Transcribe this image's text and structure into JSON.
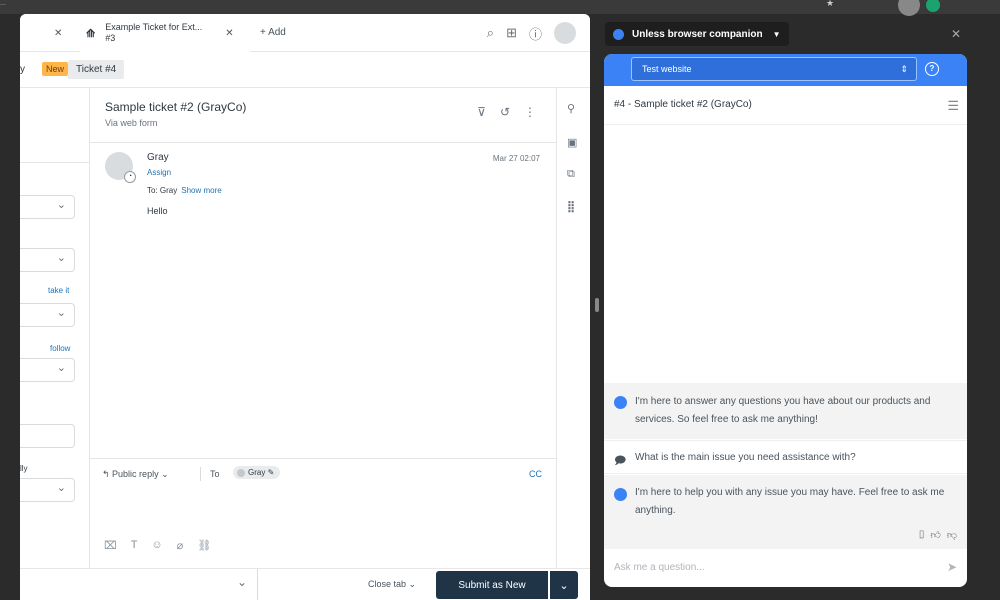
{
  "browser": {
    "url_fragment": "...",
    "colors": {
      "chrome": "#3a3a3a"
    }
  },
  "zendesk": {
    "tabs": [
      {
        "label": ""
      },
      {
        "label": "Example Ticket for Ext...",
        "sublabel": "#3"
      }
    ],
    "add_tab_label": "+ Add",
    "subbar": {
      "crumb_tail": "y",
      "new_badge": "New",
      "ticket_chip": "Ticket #4"
    },
    "left_panel": {
      "take_it": "take it",
      "follow": "follow",
      "ly_label": "lly"
    },
    "ticket": {
      "title": "Sample ticket #2 (GrayCo)",
      "channel": "Via web form",
      "message": {
        "author": "Gray",
        "assign": "Assign",
        "to_prefix": "To: Gray",
        "show_more": "Show more",
        "body": "Hello",
        "date": "Mar 27 02:07"
      }
    },
    "reply": {
      "type": "Public reply",
      "to_label": "To",
      "recipient": "Gray",
      "cc": "CC"
    },
    "bottom": {
      "close_tab": "Close tab",
      "submit": "Submit as New"
    },
    "colors": {
      "accent": "#1f73b7",
      "submit_bg": "#1f3447",
      "new_badge": "#ffb648"
    }
  },
  "companion": {
    "title": "Unless browser companion",
    "site_select": "Test website",
    "ticket_label": "#4 - Sample ticket #2 (GrayCo)",
    "messages": [
      "I'm here to answer any questions you have about our products and services. So feel free to ask me anything!",
      "What is the main issue you need assistance with?",
      "I'm here to help you with any issue you may have. Feel free to ask me anything."
    ],
    "input_placeholder": "Ask me a question...",
    "colors": {
      "header": "#3b82f6"
    }
  }
}
